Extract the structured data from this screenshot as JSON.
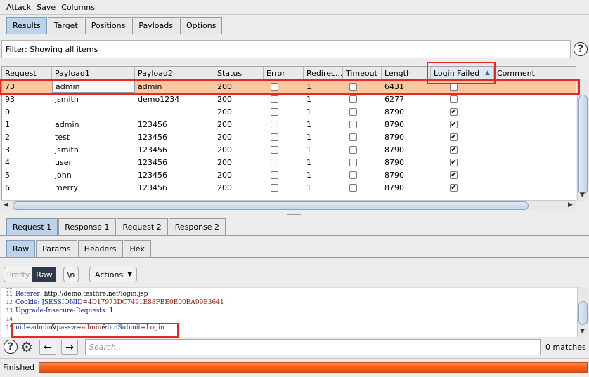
{
  "menu": [
    "Attack",
    "Save",
    "Columns"
  ],
  "top_tabs": [
    "Results",
    "Target",
    "Positions",
    "Payloads",
    "Options"
  ],
  "filter": {
    "text": "Filter: Showing all items"
  },
  "table": {
    "columns": [
      "Request",
      "Payload1",
      "Payload2",
      "Status",
      "Error",
      "Redirec...",
      "Timeout",
      "Length",
      "Login Failed",
      "Comment"
    ],
    "sort_indicator": "▲",
    "rows": [
      {
        "request": "73",
        "payload1": "admin",
        "payload2": "admin",
        "status": "200",
        "error": false,
        "redirects": "1",
        "timeout": false,
        "length": "6431",
        "login_failed": false,
        "selected": true
      },
      {
        "request": "93",
        "payload1": "jsmith",
        "payload2": "demo1234",
        "status": "200",
        "error": false,
        "redirects": "1",
        "timeout": false,
        "length": "6277",
        "login_failed": false,
        "selected": false
      },
      {
        "request": "0",
        "payload1": "",
        "payload2": "",
        "status": "200",
        "error": false,
        "redirects": "1",
        "timeout": false,
        "length": "8790",
        "login_failed": true,
        "selected": false
      },
      {
        "request": "1",
        "payload1": "admin",
        "payload2": "123456",
        "status": "200",
        "error": false,
        "redirects": "1",
        "timeout": false,
        "length": "8790",
        "login_failed": true,
        "selected": false
      },
      {
        "request": "2",
        "payload1": "test",
        "payload2": "123456",
        "status": "200",
        "error": false,
        "redirects": "1",
        "timeout": false,
        "length": "8790",
        "login_failed": true,
        "selected": false
      },
      {
        "request": "3",
        "payload1": "jsmith",
        "payload2": "123456",
        "status": "200",
        "error": false,
        "redirects": "1",
        "timeout": false,
        "length": "8790",
        "login_failed": true,
        "selected": false
      },
      {
        "request": "4",
        "payload1": "user",
        "payload2": "123456",
        "status": "200",
        "error": false,
        "redirects": "1",
        "timeout": false,
        "length": "8790",
        "login_failed": true,
        "selected": false
      },
      {
        "request": "5",
        "payload1": "john",
        "payload2": "123456",
        "status": "200",
        "error": false,
        "redirects": "1",
        "timeout": false,
        "length": "8790",
        "login_failed": true,
        "selected": false
      },
      {
        "request": "6",
        "payload1": "merry",
        "payload2": "123456",
        "status": "200",
        "error": false,
        "redirects": "1",
        "timeout": false,
        "length": "8790",
        "login_failed": true,
        "selected": false
      }
    ]
  },
  "req_tabs": [
    "Request 1",
    "Response 1",
    "Request 2",
    "Response 2"
  ],
  "view_tabs": [
    "Raw",
    "Params",
    "Headers",
    "Hex"
  ],
  "editor_toolbar": {
    "pretty": "Pretty",
    "raw": "Raw",
    "newline": "\\n",
    "actions": "Actions"
  },
  "editor_lines": [
    {
      "n": "11",
      "parts": [
        [
          "k",
          "Referer: "
        ],
        [
          "p",
          "http://demo.testfire.net/login.jsp"
        ]
      ]
    },
    {
      "n": "12",
      "parts": [
        [
          "k",
          "Cookie: "
        ],
        [
          "k",
          "JSESSIONID"
        ],
        [
          "p",
          "="
        ],
        [
          "v",
          "4D17973DC7491E88FBE0E00EA99E3641"
        ]
      ]
    },
    {
      "n": "13",
      "parts": [
        [
          "k",
          "Upgrade-Insecure-Requests: "
        ],
        [
          "p",
          "1"
        ]
      ]
    },
    {
      "n": "14",
      "parts": []
    },
    {
      "n": "15",
      "parts": [
        [
          "k",
          "uid"
        ],
        [
          "p",
          "="
        ],
        [
          "v",
          "admin"
        ],
        [
          "p",
          "&"
        ],
        [
          "k",
          "passw"
        ],
        [
          "p",
          "="
        ],
        [
          "v",
          "admin"
        ],
        [
          "p",
          "&"
        ],
        [
          "k",
          "btnSubmit"
        ],
        [
          "p",
          "="
        ],
        [
          "v",
          "Login"
        ]
      ]
    }
  ],
  "search": {
    "placeholder": "Search...",
    "matches": "0 matches"
  },
  "status": {
    "text": "Finished",
    "progress": 1.0
  },
  "colors": {
    "highlight": "#e8291f",
    "selected_row": "#f9c8a1",
    "progress": "#f25f1c"
  }
}
